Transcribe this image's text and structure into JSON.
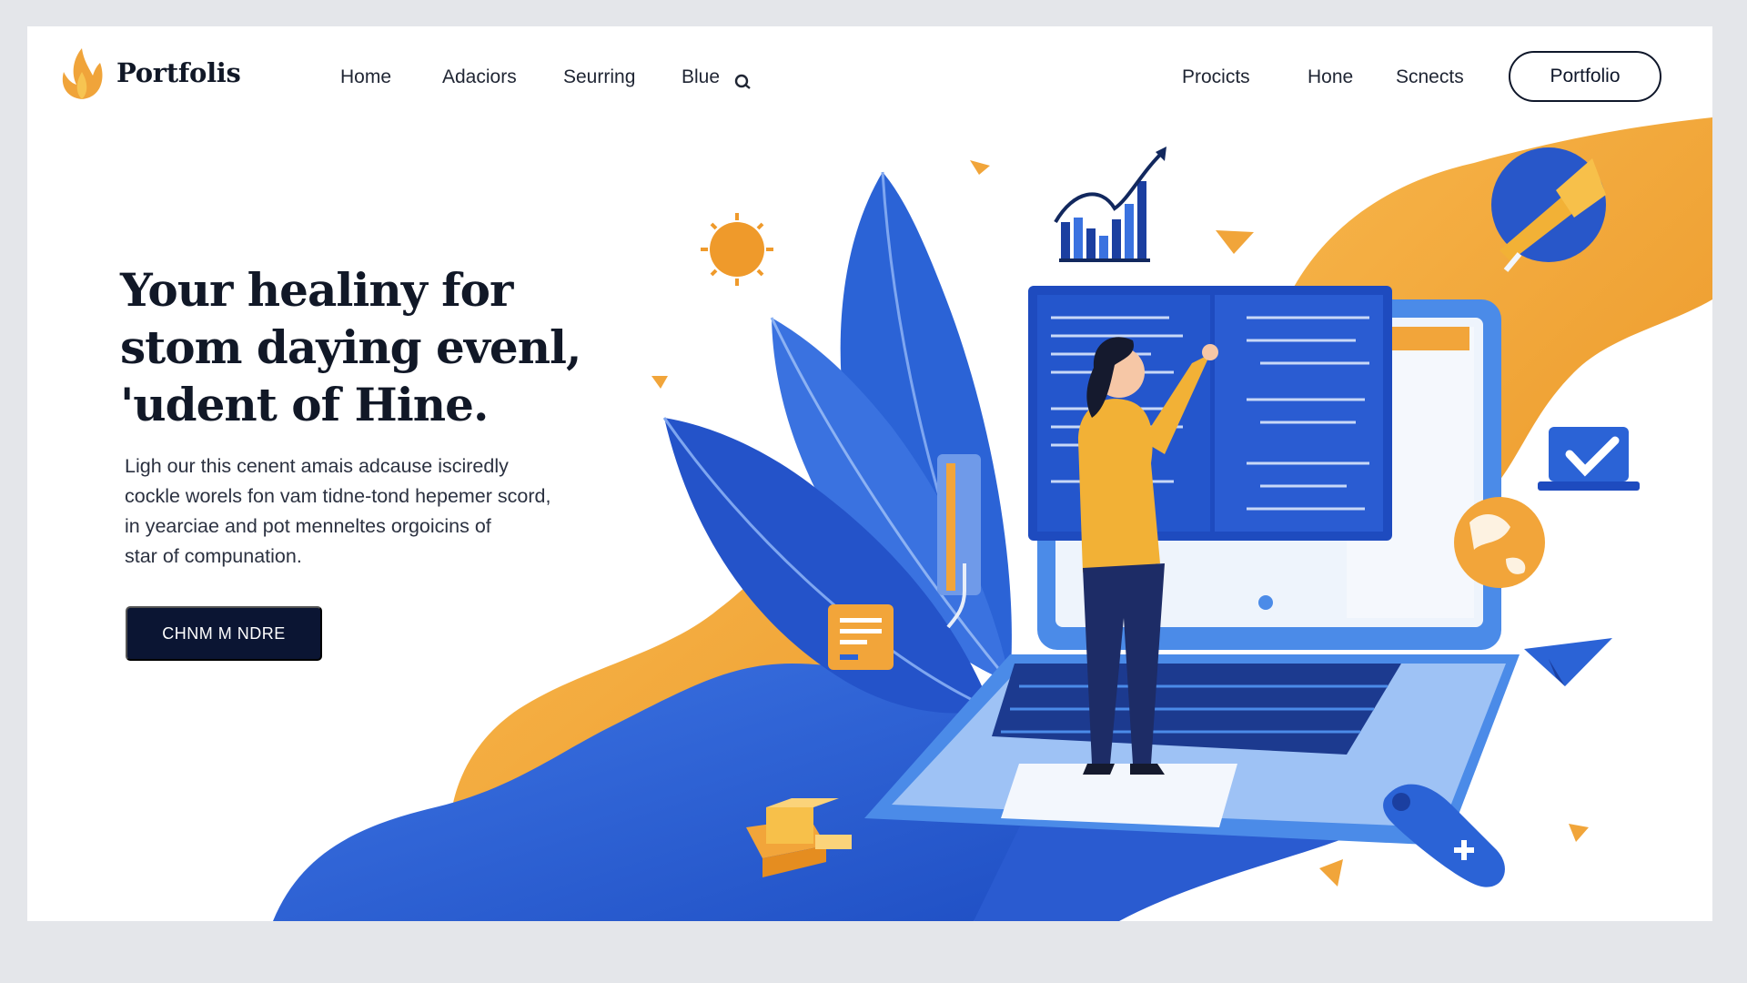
{
  "brand": {
    "name": "Portfolis"
  },
  "nav": {
    "left_links": [
      "Home",
      "Adaciors",
      "Seurring",
      "Blue"
    ],
    "right_links": [
      "Procicts",
      "Hone",
      "Scnects"
    ],
    "cta_label": "Portfolio"
  },
  "hero": {
    "title_lines": [
      "Your healiny for",
      "stom daying evenl,",
      "'udent of Hine."
    ],
    "body_lines": [
      "Ligh our this cenent amais adcause isciredly",
      "cockle worels fon vam tidne-tond hepemer scord,",
      "in yearciae and pot menneltes orgoicins of",
      "star of compunation."
    ],
    "button_label": "CHNM M NDRE"
  },
  "icons": {
    "logo": "flame-leaf-logo-icon",
    "search": "search-icon",
    "megaphone": "megaphone-icon",
    "laptop_check": "laptop-check-icon",
    "globe": "globe-icon",
    "bar_chart": "bar-chart-icon",
    "document": "document-icon",
    "package": "package-icon",
    "controller": "game-controller-icon",
    "paper_plane": "paper-plane-icon",
    "sun": "sun-icon"
  },
  "colors": {
    "accent_blue": "#2f63d6",
    "accent_orange": "#f0a43a",
    "navy": "#0b1533",
    "text_dark": "#111827"
  }
}
